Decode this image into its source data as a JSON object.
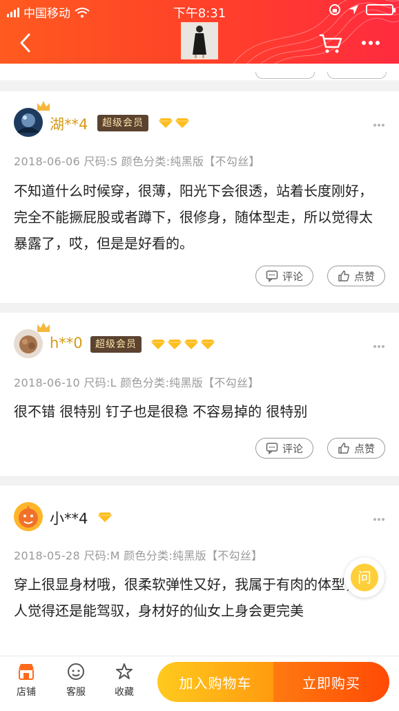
{
  "status_bar": {
    "carrier": "中国移动",
    "time": "下午8:31"
  },
  "nav": {
    "back_icon": "chevron-left-icon",
    "cart_icon": "cart-icon",
    "more_icon": "ellipsis-icon"
  },
  "reviews": [
    {
      "user": "湖**4",
      "badge": "超级会员",
      "diamonds": 2,
      "meta": "2018-06-06  尺码:S 颜色分类:纯黑版【不勾丝】",
      "content": "不知道什么时候穿，很薄，阳光下会很透，站着长度刚好，完全不能撅屁股或者蹲下，很修身，随体型走，所以觉得太暴露了，哎，但是是好看的。",
      "comment_label": "评论",
      "like_label": "点赞"
    },
    {
      "user": "h**0",
      "badge": "超级会员",
      "diamonds": 4,
      "meta": "2018-06-10  尺码:L 颜色分类:纯黑版【不勾丝】",
      "content": "很不错 很特别 钉子也是很稳 不容易掉的 很特别",
      "comment_label": "评论",
      "like_label": "点赞"
    },
    {
      "user": "小**4",
      "badge": "",
      "diamonds": 1,
      "meta": "2018-05-28  尺码:M 颜色分类:纯黑版【不勾丝】",
      "content": "穿上很显身材哦，很柔软弹性又好，我属于有肉的体型，个人觉得还是能驾驭，身材好的仙女上身会更完美"
    }
  ],
  "ask_button": "问",
  "bottom_bar": {
    "shop_label": "店铺",
    "service_label": "客服",
    "favorite_label": "收藏",
    "add_to_cart": "加入购物车",
    "buy_now": "立即购买"
  },
  "colors": {
    "header": "#ff4a2a",
    "vip_badge": "#5b4330",
    "username_gold": "#d49a18",
    "add_to_cart": "#ffb414",
    "buy_now": "#ff5a08"
  }
}
